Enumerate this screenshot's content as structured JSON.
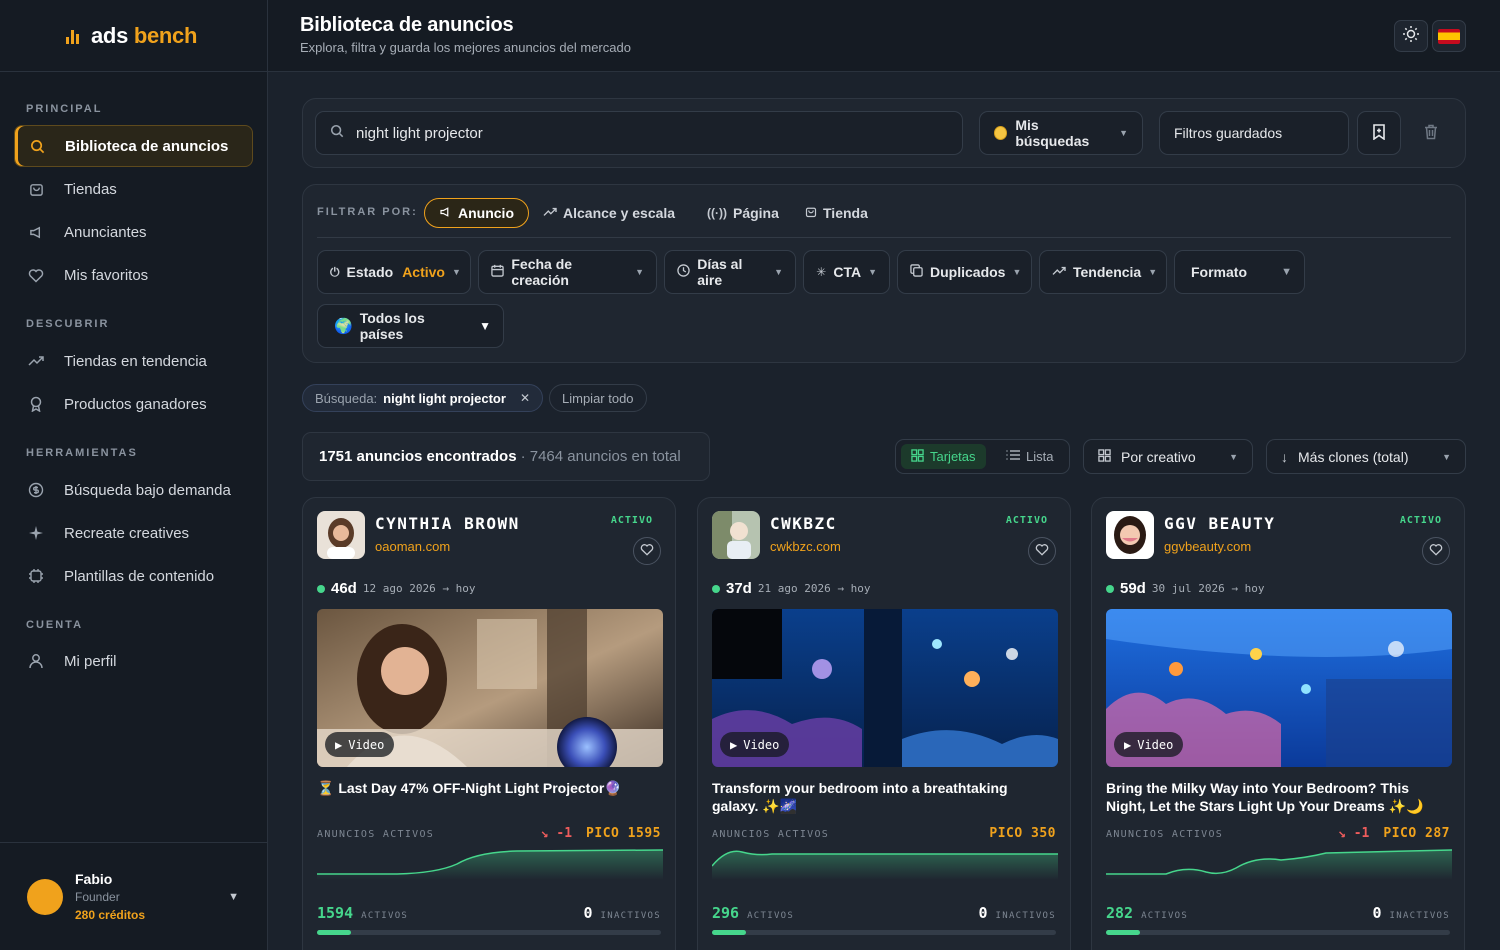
{
  "brand": {
    "name_prefix": "ads",
    "name_accent": "bench"
  },
  "sidebar": {
    "sections": [
      {
        "label": "PRINCIPAL",
        "items": [
          {
            "label": "Biblioteca de anuncios",
            "icon": "search-icon",
            "active": true
          },
          {
            "label": "Tiendas",
            "icon": "store-icon"
          },
          {
            "label": "Anunciantes",
            "icon": "megaphone-icon"
          },
          {
            "label": "Mis favoritos",
            "icon": "heart-icon"
          }
        ]
      },
      {
        "label": "DESCUBRIR",
        "items": [
          {
            "label": "Tiendas en tendencia",
            "icon": "trending-icon"
          },
          {
            "label": "Productos ganadores",
            "icon": "award-icon"
          }
        ]
      },
      {
        "label": "HERRAMIENTAS",
        "items": [
          {
            "label": "Búsqueda bajo demanda",
            "icon": "dollar-circle-icon"
          },
          {
            "label": "Recreate creatives",
            "icon": "sparkle-icon"
          },
          {
            "label": "Plantillas de contenido",
            "icon": "template-icon"
          }
        ]
      },
      {
        "label": "CUENTA",
        "items": [
          {
            "label": "Mi perfil",
            "icon": "user-icon"
          }
        ]
      }
    ]
  },
  "user": {
    "name": "Fabio",
    "role": "Founder",
    "credits": "280 créditos"
  },
  "header": {
    "title": "Biblioteca de anuncios",
    "subtitle": "Explora, filtra y guarda los mejores anuncios del mercado"
  },
  "search": {
    "value": "night light projector",
    "my_searches": "Mis búsquedas",
    "saved_filters": "Filtros guardados"
  },
  "filters": {
    "label": "FILTRAR POR:",
    "tabs": [
      {
        "label": "Anuncio",
        "icon": "megaphone-icon",
        "active": true
      },
      {
        "label": "Alcance y escala",
        "icon": "trending-icon"
      },
      {
        "label": "Página",
        "icon": "broadcast-icon"
      },
      {
        "label": "Tienda",
        "icon": "store-icon"
      }
    ],
    "estado_label": "Estado",
    "estado_value": "Activo",
    "fecha_creacion": "Fecha de creación",
    "dias_al_aire": "Días al aire",
    "cta": "CTA",
    "duplicados": "Duplicados",
    "tendencia": "Tendencia",
    "formato": "Formato",
    "paises": "Todos los países"
  },
  "active_chips": {
    "search_label": "Búsqueda:",
    "search_value": "night light projector",
    "clear_all": "Limpiar todo"
  },
  "results": {
    "found": "1751 anuncios encontrados",
    "total": "· 7464 anuncios en total"
  },
  "view": {
    "cards": "Tarjetas",
    "list": "Lista"
  },
  "sort": {
    "by_creative": "Por creativo",
    "clones": "Más clones (total)"
  },
  "colors": {
    "accent": "#f0a21c",
    "active_green": "#46d68c",
    "negative_red": "#ee5c5c"
  },
  "cards": [
    {
      "name": "CYNTHIA BROWN",
      "domain": "oaoman.com",
      "status": "ACTIVO",
      "days": "46d",
      "range": "12 ago 2026 → hoy",
      "media": "Video",
      "copy": "⏳ Last Day 47% OFF-Night Light Projector🔮",
      "stat_label": "ANUNCIOS ACTIVOS",
      "delta": "↘ -1",
      "peak": "PICO 1595",
      "active": "1594",
      "active_label": "ACTIVOS",
      "inactive": "0",
      "inactive_label": "INACTIVOS",
      "active_share": 0.1
    },
    {
      "name": "CWKBZC",
      "domain": "cwkbzc.com",
      "status": "ACTIVO",
      "days": "37d",
      "range": "21 ago 2026 → hoy",
      "media": "Video",
      "copy": "Transform your bedroom into a breathtaking galaxy. ✨🌌",
      "stat_label": "ANUNCIOS ACTIVOS",
      "delta": "",
      "peak": "PICO 350",
      "active": "296",
      "active_label": "ACTIVOS",
      "inactive": "0",
      "inactive_label": "INACTIVOS",
      "active_share": 0.1
    },
    {
      "name": "GGV BEAUTY",
      "domain": "ggvbeauty.com",
      "status": "ACTIVO",
      "days": "59d",
      "range": "30 jul 2026 → hoy",
      "media": "Video",
      "copy": "Bring the Milky Way into Your Bedroom? This Night, Let the Stars Light Up Your Dreams ✨🌙",
      "stat_label": "ANUNCIOS ACTIVOS",
      "delta": "↘ -1",
      "peak": "PICO 287",
      "active": "282",
      "active_label": "ACTIVOS",
      "inactive": "0",
      "inactive_label": "INACTIVOS",
      "active_share": 0.1
    }
  ]
}
